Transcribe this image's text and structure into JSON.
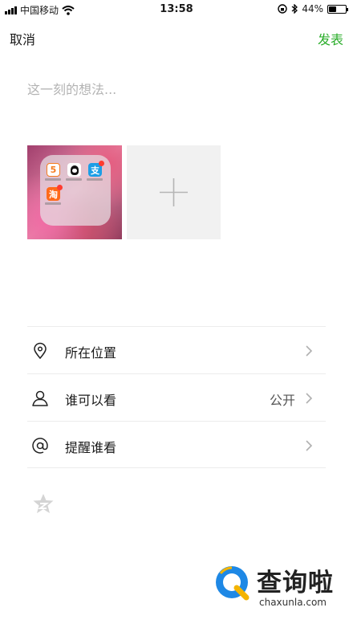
{
  "status_bar": {
    "carrier": "中国移动",
    "time": "13:58",
    "battery_percent": "44%",
    "battery_level": 0.44
  },
  "nav": {
    "cancel_label": "取消",
    "publish_label": "发表",
    "publish_color": "#2aad2a"
  },
  "composer": {
    "placeholder": "这一刻的想法...",
    "value": ""
  },
  "images": {
    "thumbnail_icon": "phone-folder-screenshot",
    "add_icon": "plus-icon"
  },
  "options": [
    {
      "icon": "location-pin-icon",
      "label": "所在位置",
      "value": ""
    },
    {
      "icon": "person-icon",
      "label": "谁可以看",
      "value": "公开"
    },
    {
      "icon": "at-sign-icon",
      "label": "提醒谁看",
      "value": ""
    }
  ],
  "watermark": {
    "brand": "查询啦",
    "domain": "chaxunla.com"
  }
}
